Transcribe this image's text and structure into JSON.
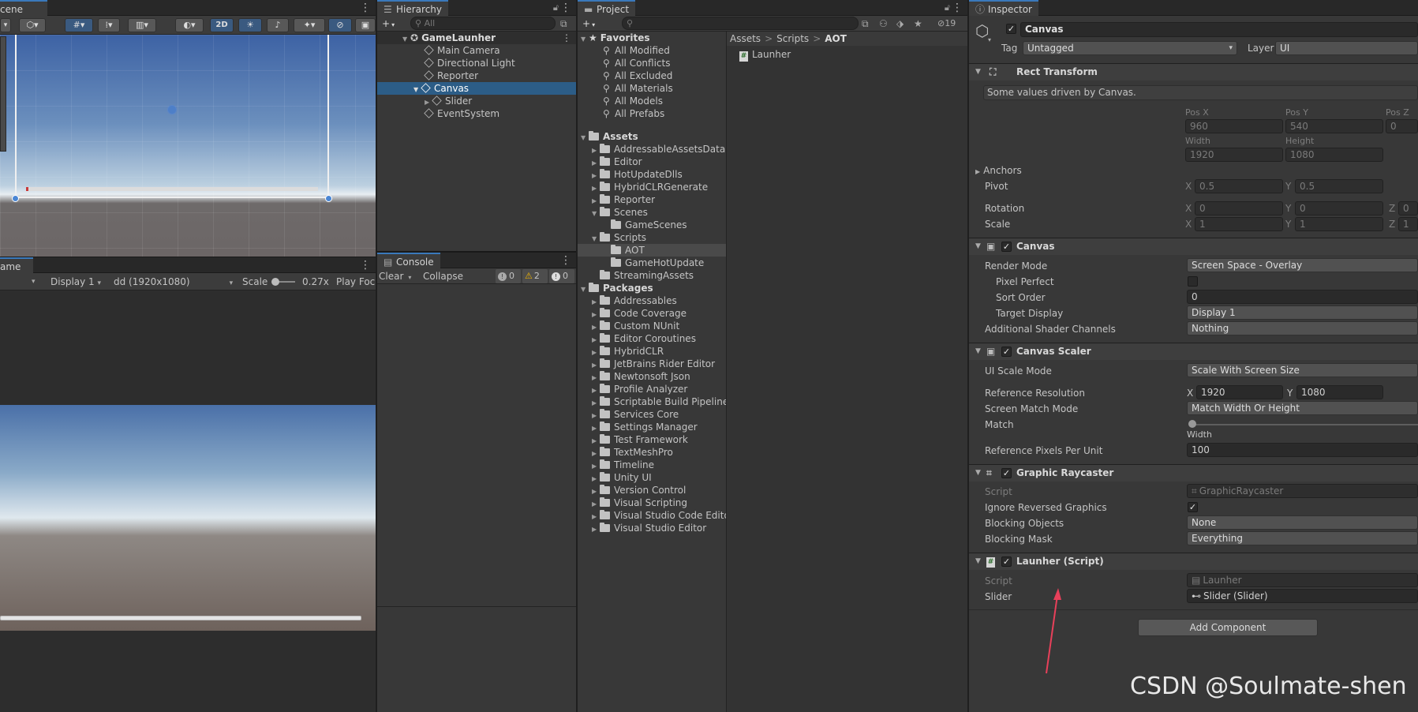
{
  "scene": {
    "tab_label": "cene",
    "toggle_2d": "2D"
  },
  "game": {
    "tab_label": "ame",
    "display": "Display 1",
    "resolution": "dd (1920x1080)",
    "scale_label": "Scale",
    "scale_value": "0.27x",
    "play_focus": "Play Foc"
  },
  "hierarchy": {
    "tab_label": "Hierarchy",
    "search_placeholder": "All",
    "root": "GameLaunher",
    "items": [
      {
        "label": "Main Camera"
      },
      {
        "label": "Directional Light"
      },
      {
        "label": "Reporter"
      },
      {
        "label": "Canvas"
      },
      {
        "label": "Slider"
      },
      {
        "label": "EventSystem"
      }
    ]
  },
  "console": {
    "tab_label": "Console",
    "clear": "Clear",
    "collapse": "Collapse",
    "log_count": "0",
    "warn_count": "2",
    "error_count": "0"
  },
  "project": {
    "tab_label": "Project",
    "hidden_count": "19",
    "favorites_label": "Favorites",
    "favorites": [
      "All Modified",
      "All Conflicts",
      "All Excluded",
      "All Materials",
      "All Models",
      "All Prefabs"
    ],
    "assets_label": "Assets",
    "assets": [
      "AddressableAssetsData",
      "Editor",
      "HotUpdateDlls",
      "HybridCLRGenerate",
      "Reporter",
      "Scenes",
      "GameScenes",
      "Scripts",
      "AOT",
      "GameHotUpdate",
      "StreamingAssets"
    ],
    "packages_label": "Packages",
    "packages": [
      "Addressables",
      "Code Coverage",
      "Custom NUnit",
      "Editor Coroutines",
      "HybridCLR",
      "JetBrains Rider Editor",
      "Newtonsoft Json",
      "Profile Analyzer",
      "Scriptable Build Pipeline",
      "Services Core",
      "Settings Manager",
      "Test Framework",
      "TextMeshPro",
      "Timeline",
      "Unity UI",
      "Version Control",
      "Visual Scripting",
      "Visual Studio Code Editor",
      "Visual Studio Editor"
    ],
    "breadcrumb": [
      "Assets",
      "Scripts",
      "AOT"
    ],
    "files": [
      "Launher"
    ]
  },
  "inspector": {
    "tab_label": "Inspector",
    "object_name": "Canvas",
    "tag_label": "Tag",
    "tag_value": "Untagged",
    "layer_label": "Layer",
    "layer_value": "UI",
    "rect_transform": {
      "title": "Rect Transform",
      "note": "Some values driven by Canvas.",
      "posx_label": "Pos X",
      "posx": "960",
      "posy_label": "Pos Y",
      "posy": "540",
      "posz_label": "Pos Z",
      "posz": "0",
      "width_label": "Width",
      "width": "1920",
      "height_label": "Height",
      "height": "1080",
      "anchors": "Anchors",
      "pivot": "Pivot",
      "pivot_x": "0.5",
      "pivot_y": "0.5",
      "rotation": "Rotation",
      "rot_x": "0",
      "rot_y": "0",
      "rot_z": "0",
      "scale": "Scale",
      "scale_x": "1",
      "scale_y": "1",
      "scale_z": "1",
      "x": "X",
      "y": "Y",
      "z": "Z"
    },
    "canvas": {
      "title": "Canvas",
      "render_mode_label": "Render Mode",
      "render_mode": "Screen Space - Overlay",
      "pixel_perfect": "Pixel Perfect",
      "sort_order_label": "Sort Order",
      "sort_order": "0",
      "target_display_label": "Target Display",
      "target_display": "Display 1",
      "shader_channels_label": "Additional Shader Channels",
      "shader_channels": "Nothing"
    },
    "canvas_scaler": {
      "title": "Canvas Scaler",
      "ui_scale_mode_label": "UI Scale Mode",
      "ui_scale_mode": "Scale With Screen Size",
      "ref_res_label": "Reference Resolution",
      "ref_x": "1920",
      "ref_y": "1080",
      "match_mode_label": "Screen Match Mode",
      "match_mode": "Match Width Or Height",
      "match_label": "Match",
      "match_value": 0,
      "match_left": "Width",
      "ppu_label": "Reference Pixels Per Unit",
      "ppu": "100"
    },
    "graphic_raycaster": {
      "title": "Graphic Raycaster",
      "script_label": "Script",
      "script": "GraphicRaycaster",
      "ignore_reversed": "Ignore Reversed Graphics",
      "blocking_objects_label": "Blocking Objects",
      "blocking_objects": "None",
      "blocking_mask_label": "Blocking Mask",
      "blocking_mask": "Everything"
    },
    "launher": {
      "title": "Launher (Script)",
      "script_label": "Script",
      "script": "Launher",
      "slider_label": "Slider",
      "slider": "Slider (Slider)"
    },
    "add_component": "Add Component"
  },
  "watermark": "CSDN @Soulmate-shen",
  "colors": {
    "selection": "#2c5d87",
    "accent": "#3a79bb",
    "annotation_arrow": "#e8405a"
  }
}
